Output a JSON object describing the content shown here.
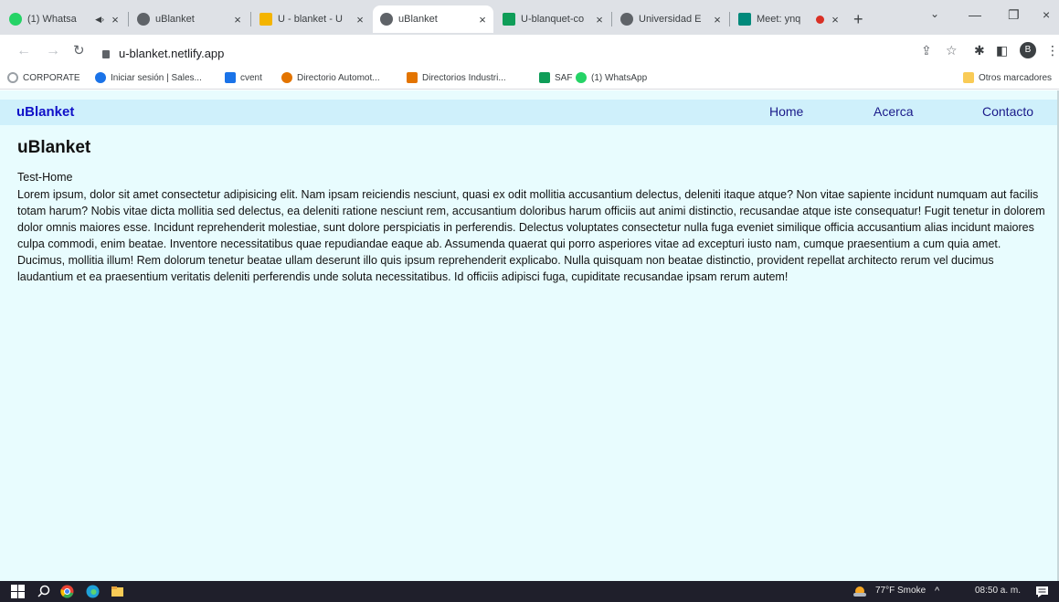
{
  "browser": {
    "tabs": [
      {
        "title": "(1) Whatsa",
        "active": false,
        "favicon_color": "#25d366"
      },
      {
        "title": "uBlanket",
        "active": false,
        "favicon_color": "#5f6368"
      },
      {
        "title": "U - blanket - U",
        "active": false,
        "favicon_color": "#f4b400"
      },
      {
        "title": "uBlanket",
        "active": true,
        "favicon_color": "#5f6368"
      },
      {
        "title": "U-blanquet-co",
        "active": false,
        "favicon_color": "#0f9d58"
      },
      {
        "title": "Universidad E",
        "active": false,
        "favicon_color": "#5f6368"
      },
      {
        "title": "Meet: ynq",
        "active": false,
        "favicon_color": "#00897b"
      }
    ],
    "new_tab_glyph": "+",
    "close_glyph": "×",
    "window_controls": {
      "chevron": "⌄",
      "minimize": "—",
      "restore": "❐",
      "close": "×"
    },
    "url": "u-blanket.netlify.app",
    "profile_initial": "B",
    "bookmarks": [
      {
        "label": "CORPORATE",
        "icon_color": "#f4b400"
      },
      {
        "label": "Iniciar sesión | Sales...",
        "icon_color": "#1a73e8"
      },
      {
        "label": "cvent",
        "icon_color": "#1a73e8"
      },
      {
        "label": "Directorio Automot...",
        "icon_color": "#e37400"
      },
      {
        "label": "Directorios Industri...",
        "icon_color": "#e37400"
      },
      {
        "label": "SAF",
        "icon_color": "#0f9d58"
      },
      {
        "label": "(1) WhatsApp",
        "icon_color": "#25d366"
      }
    ],
    "other_bookmarks": "Otros marcadores"
  },
  "site": {
    "brand": "uBlanket",
    "nav": {
      "home": "Home",
      "about": "Acerca",
      "contact": "Contacto"
    },
    "title": "uBlanket",
    "subtitle": "Test-Home",
    "body": "Lorem ipsum, dolor sit amet consectetur adipisicing elit. Nam ipsam reiciendis nesciunt, quasi ex odit mollitia accusantium delectus, deleniti itaque atque? Non vitae sapiente incidunt numquam aut facilis totam harum? Nobis vitae dicta mollitia sed delectus, ea deleniti ratione nesciunt rem, accusantium doloribus harum officiis aut animi distinctio, recusandae atque iste consequatur! Fugit tenetur in dolorem dolor omnis maiores esse. Incidunt reprehenderit molestiae, sunt dolore perspiciatis in perferendis. Delectus voluptates consectetur nulla fuga eveniet similique officia accusantium alias incidunt maiores culpa commodi, enim beatae. Inventore necessitatibus quae repudiandae eaque ab. Assumenda quaerat qui porro asperiores vitae ad excepturi iusto nam, cumque praesentium a cum quia amet. Ducimus, mollitia illum! Rem dolorum tenetur beatae ullam deserunt illo quis ipsum reprehenderit explicabo. Nulla quisquam non beatae distinctio, provident repellat architecto rerum vel ducimus laudantium et ea praesentium veritatis deleniti perferendis unde soluta necessitatibus. Id officiis adipisci fuga, cupiditate recusandae ipsam rerum autem!"
  },
  "taskbar": {
    "weather": "77°F Smoke",
    "time": "08:50 a. m."
  }
}
